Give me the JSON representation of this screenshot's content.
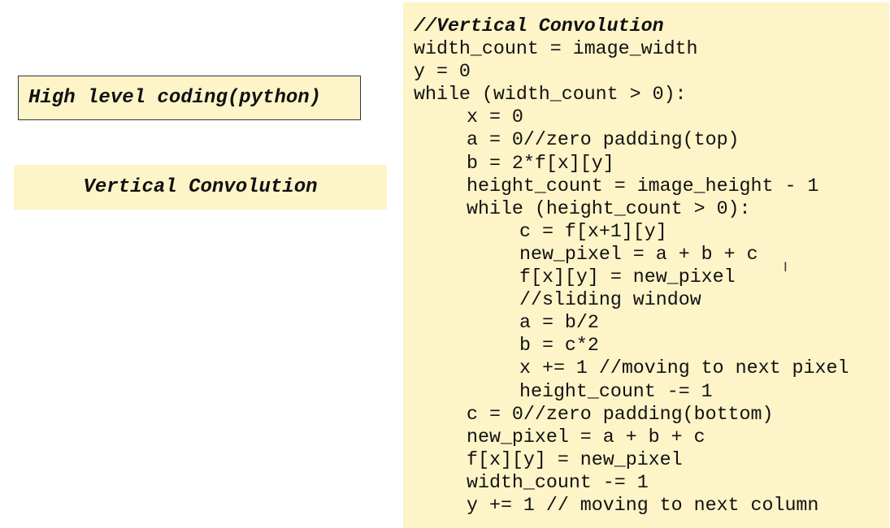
{
  "slide": {
    "title": "High level coding(python)",
    "subtitle": "Vertical Convolution",
    "code_lines": [
      {
        "text": "//Vertical Convolution",
        "indent": 0,
        "heading": true
      },
      {
        "text": "width_count = image_width",
        "indent": 0
      },
      {
        "text": "y = 0",
        "indent": 0
      },
      {
        "text": "while (width_count > 0):",
        "indent": 0
      },
      {
        "text": "x = 0",
        "indent": 1
      },
      {
        "text": "a = 0//zero padding(top)",
        "indent": 1
      },
      {
        "text": "b = 2*f[x][y]",
        "indent": 1
      },
      {
        "text": "height_count = image_height - 1",
        "indent": 1
      },
      {
        "text": "while (height_count > 0):",
        "indent": 1
      },
      {
        "text": "c = f[x+1][y]",
        "indent": 2
      },
      {
        "text": "new_pixel = a + b + c",
        "indent": 2
      },
      {
        "text": "f[x][y] = new_pixel",
        "indent": 2
      },
      {
        "text": "//sliding window",
        "indent": 2
      },
      {
        "text": "a = b/2",
        "indent": 2
      },
      {
        "text": "b = c*2",
        "indent": 2
      },
      {
        "text": "x += 1 //moving to next pixel",
        "indent": 2
      },
      {
        "text": "height_count -= 1",
        "indent": 2
      },
      {
        "text": "c = 0//zero padding(bottom)",
        "indent": 1
      },
      {
        "text": "new_pixel = a + b + c",
        "indent": 1
      },
      {
        "text": "f[x][y] = new_pixel",
        "indent": 1
      },
      {
        "text": "width_count -= 1",
        "indent": 1
      },
      {
        "text": "y += 1 // moving to next column",
        "indent": 1
      }
    ]
  },
  "colors": {
    "panel_background": "#fdf4c8",
    "text": "#111111",
    "border": "#333333"
  },
  "icons": {
    "cursor": "text-cursor-icon"
  }
}
